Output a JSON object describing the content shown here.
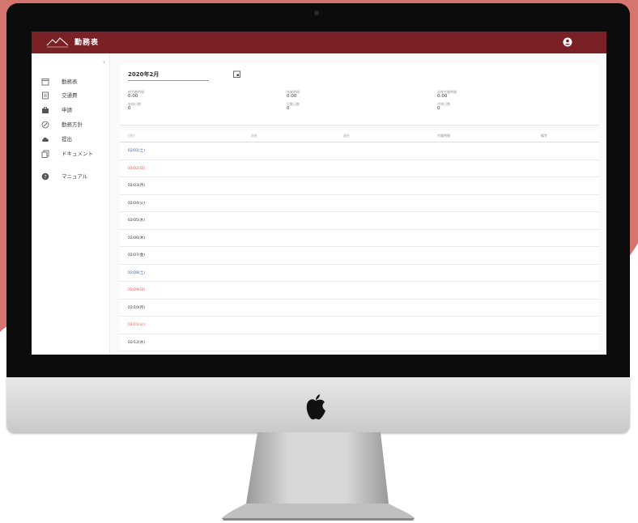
{
  "colors": {
    "brand": "#7a2126",
    "background_shape": "#d4756f",
    "saturday": "#3a55b4",
    "sunday": "#e0594e"
  },
  "header": {
    "title": "勤務表",
    "logo_icon": "mountain-logo-icon",
    "user_icon": "account-circle-icon"
  },
  "sidebar": {
    "collapse_icon": "chevron-left-icon",
    "items": [
      {
        "label": "勤務表",
        "icon": "calendar-icon"
      },
      {
        "label": "交通費",
        "icon": "receipt-icon"
      },
      {
        "label": "申請",
        "icon": "briefcase-icon"
      },
      {
        "label": "勤務方針",
        "icon": "compass-icon"
      },
      {
        "label": "提出",
        "icon": "cloud-upload-icon"
      },
      {
        "label": "ドキュメント",
        "icon": "documents-icon"
      },
      {
        "label": "マニュアル",
        "icon": "help-icon"
      }
    ]
  },
  "summary": {
    "month": "2020年2月",
    "stats": [
      {
        "label": "総労働時間",
        "value": "0:00"
      },
      {
        "label": "残業時間",
        "value": "0:00"
      },
      {
        "label": "深夜労働時間",
        "value": "0:00"
      },
      {
        "label": "有休日数",
        "value": "0"
      },
      {
        "label": "欠勤日数",
        "value": "0"
      },
      {
        "label": "代休日数",
        "value": "0"
      }
    ]
  },
  "table": {
    "headers": [
      "日付",
      "出社",
      "退社",
      "労働時間",
      "備考"
    ],
    "rows": [
      {
        "date": "02/01(土)",
        "type": "saturday"
      },
      {
        "date": "02/02(日)",
        "type": "sunday"
      },
      {
        "date": "02/03(月)",
        "type": "weekday"
      },
      {
        "date": "02/04(火)",
        "type": "weekday"
      },
      {
        "date": "02/05(水)",
        "type": "weekday"
      },
      {
        "date": "02/06(木)",
        "type": "weekday"
      },
      {
        "date": "02/07(金)",
        "type": "weekday"
      },
      {
        "date": "02/08(土)",
        "type": "saturday"
      },
      {
        "date": "02/09(日)",
        "type": "sunday"
      },
      {
        "date": "02/10(月)",
        "type": "weekday"
      },
      {
        "date": "02/11(火)",
        "type": "holiday"
      },
      {
        "date": "02/12(水)",
        "type": "weekday"
      }
    ]
  },
  "device": {
    "logo_icon": "apple-logo-icon"
  }
}
